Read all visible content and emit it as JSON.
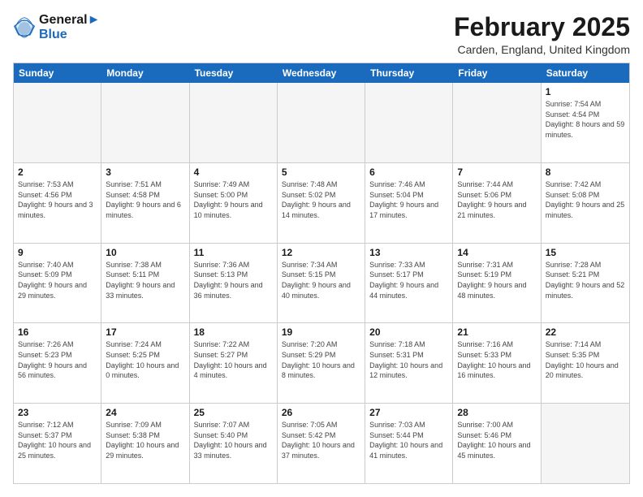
{
  "logo": {
    "line1": "General",
    "line2": "Blue"
  },
  "title": "February 2025",
  "location": "Carden, England, United Kingdom",
  "weekdays": [
    "Sunday",
    "Monday",
    "Tuesday",
    "Wednesday",
    "Thursday",
    "Friday",
    "Saturday"
  ],
  "weeks": [
    [
      {
        "day": "",
        "info": ""
      },
      {
        "day": "",
        "info": ""
      },
      {
        "day": "",
        "info": ""
      },
      {
        "day": "",
        "info": ""
      },
      {
        "day": "",
        "info": ""
      },
      {
        "day": "",
        "info": ""
      },
      {
        "day": "1",
        "info": "Sunrise: 7:54 AM\nSunset: 4:54 PM\nDaylight: 8 hours and 59 minutes."
      }
    ],
    [
      {
        "day": "2",
        "info": "Sunrise: 7:53 AM\nSunset: 4:56 PM\nDaylight: 9 hours and 3 minutes."
      },
      {
        "day": "3",
        "info": "Sunrise: 7:51 AM\nSunset: 4:58 PM\nDaylight: 9 hours and 6 minutes."
      },
      {
        "day": "4",
        "info": "Sunrise: 7:49 AM\nSunset: 5:00 PM\nDaylight: 9 hours and 10 minutes."
      },
      {
        "day": "5",
        "info": "Sunrise: 7:48 AM\nSunset: 5:02 PM\nDaylight: 9 hours and 14 minutes."
      },
      {
        "day": "6",
        "info": "Sunrise: 7:46 AM\nSunset: 5:04 PM\nDaylight: 9 hours and 17 minutes."
      },
      {
        "day": "7",
        "info": "Sunrise: 7:44 AM\nSunset: 5:06 PM\nDaylight: 9 hours and 21 minutes."
      },
      {
        "day": "8",
        "info": "Sunrise: 7:42 AM\nSunset: 5:08 PM\nDaylight: 9 hours and 25 minutes."
      }
    ],
    [
      {
        "day": "9",
        "info": "Sunrise: 7:40 AM\nSunset: 5:09 PM\nDaylight: 9 hours and 29 minutes."
      },
      {
        "day": "10",
        "info": "Sunrise: 7:38 AM\nSunset: 5:11 PM\nDaylight: 9 hours and 33 minutes."
      },
      {
        "day": "11",
        "info": "Sunrise: 7:36 AM\nSunset: 5:13 PM\nDaylight: 9 hours and 36 minutes."
      },
      {
        "day": "12",
        "info": "Sunrise: 7:34 AM\nSunset: 5:15 PM\nDaylight: 9 hours and 40 minutes."
      },
      {
        "day": "13",
        "info": "Sunrise: 7:33 AM\nSunset: 5:17 PM\nDaylight: 9 hours and 44 minutes."
      },
      {
        "day": "14",
        "info": "Sunrise: 7:31 AM\nSunset: 5:19 PM\nDaylight: 9 hours and 48 minutes."
      },
      {
        "day": "15",
        "info": "Sunrise: 7:28 AM\nSunset: 5:21 PM\nDaylight: 9 hours and 52 minutes."
      }
    ],
    [
      {
        "day": "16",
        "info": "Sunrise: 7:26 AM\nSunset: 5:23 PM\nDaylight: 9 hours and 56 minutes."
      },
      {
        "day": "17",
        "info": "Sunrise: 7:24 AM\nSunset: 5:25 PM\nDaylight: 10 hours and 0 minutes."
      },
      {
        "day": "18",
        "info": "Sunrise: 7:22 AM\nSunset: 5:27 PM\nDaylight: 10 hours and 4 minutes."
      },
      {
        "day": "19",
        "info": "Sunrise: 7:20 AM\nSunset: 5:29 PM\nDaylight: 10 hours and 8 minutes."
      },
      {
        "day": "20",
        "info": "Sunrise: 7:18 AM\nSunset: 5:31 PM\nDaylight: 10 hours and 12 minutes."
      },
      {
        "day": "21",
        "info": "Sunrise: 7:16 AM\nSunset: 5:33 PM\nDaylight: 10 hours and 16 minutes."
      },
      {
        "day": "22",
        "info": "Sunrise: 7:14 AM\nSunset: 5:35 PM\nDaylight: 10 hours and 20 minutes."
      }
    ],
    [
      {
        "day": "23",
        "info": "Sunrise: 7:12 AM\nSunset: 5:37 PM\nDaylight: 10 hours and 25 minutes."
      },
      {
        "day": "24",
        "info": "Sunrise: 7:09 AM\nSunset: 5:38 PM\nDaylight: 10 hours and 29 minutes."
      },
      {
        "day": "25",
        "info": "Sunrise: 7:07 AM\nSunset: 5:40 PM\nDaylight: 10 hours and 33 minutes."
      },
      {
        "day": "26",
        "info": "Sunrise: 7:05 AM\nSunset: 5:42 PM\nDaylight: 10 hours and 37 minutes."
      },
      {
        "day": "27",
        "info": "Sunrise: 7:03 AM\nSunset: 5:44 PM\nDaylight: 10 hours and 41 minutes."
      },
      {
        "day": "28",
        "info": "Sunrise: 7:00 AM\nSunset: 5:46 PM\nDaylight: 10 hours and 45 minutes."
      },
      {
        "day": "",
        "info": ""
      }
    ]
  ]
}
